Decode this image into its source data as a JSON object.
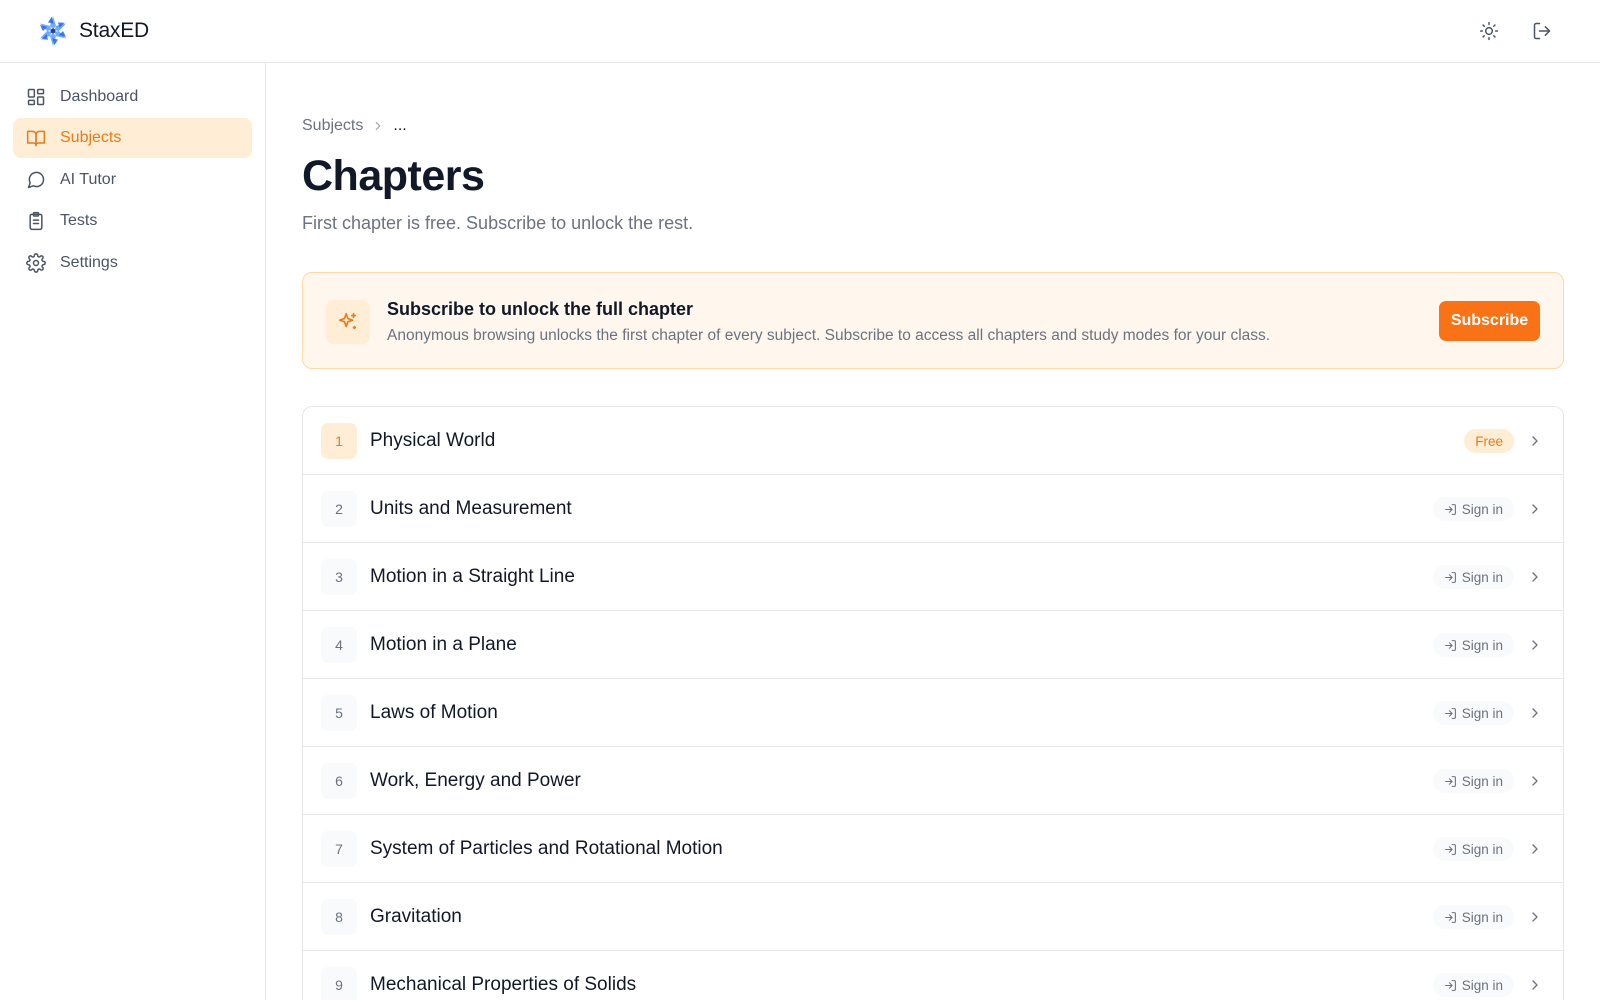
{
  "app": {
    "brand": "StaxED"
  },
  "header": {
    "theme_icon": "sun-icon",
    "logout_icon": "log-out-icon"
  },
  "sidebar": {
    "items": [
      {
        "label": "Dashboard",
        "icon": "dashboard-icon",
        "active": false
      },
      {
        "label": "Subjects",
        "icon": "book-icon",
        "active": true
      },
      {
        "label": "AI Tutor",
        "icon": "chat-bubble-icon",
        "active": false
      },
      {
        "label": "Tests",
        "icon": "clipboard-icon",
        "active": false
      },
      {
        "label": "Settings",
        "icon": "gear-icon",
        "active": false
      }
    ]
  },
  "breadcrumb": {
    "root": "Subjects",
    "current": "..."
  },
  "page": {
    "title": "Chapters",
    "subtitle": "First chapter is free. Subscribe to unlock the rest."
  },
  "banner": {
    "icon": "sparkle-icon",
    "title": "Subscribe to unlock the full chapter",
    "text": "Anonymous browsing unlocks the first chapter of every subject. Subscribe to access all chapters and study modes for your class.",
    "button_label": "Subscribe"
  },
  "chapters": [
    {
      "number": "1",
      "title": "Physical World",
      "badge": "Free",
      "free": true
    },
    {
      "number": "2",
      "title": "Units and Measurement",
      "badge": "Sign in",
      "free": false
    },
    {
      "number": "3",
      "title": "Motion in a Straight Line",
      "badge": "Sign in",
      "free": false
    },
    {
      "number": "4",
      "title": "Motion in a Plane",
      "badge": "Sign in",
      "free": false
    },
    {
      "number": "5",
      "title": "Laws of Motion",
      "badge": "Sign in",
      "free": false
    },
    {
      "number": "6",
      "title": "Work, Energy and Power",
      "badge": "Sign in",
      "free": false
    },
    {
      "number": "7",
      "title": "System of Particles and Rotational Motion",
      "badge": "Sign in",
      "free": false
    },
    {
      "number": "8",
      "title": "Gravitation",
      "badge": "Sign in",
      "free": false
    },
    {
      "number": "9",
      "title": "Mechanical Properties of Solids",
      "badge": "Sign in",
      "free": false
    }
  ],
  "colors": {
    "accent": "#f97316",
    "accent_text": "#ea7a1a",
    "accent_soft": "#ffedd5",
    "banner_bg": "#fff7ed",
    "border": "#e5e7eb",
    "muted_text": "#6b7280"
  }
}
